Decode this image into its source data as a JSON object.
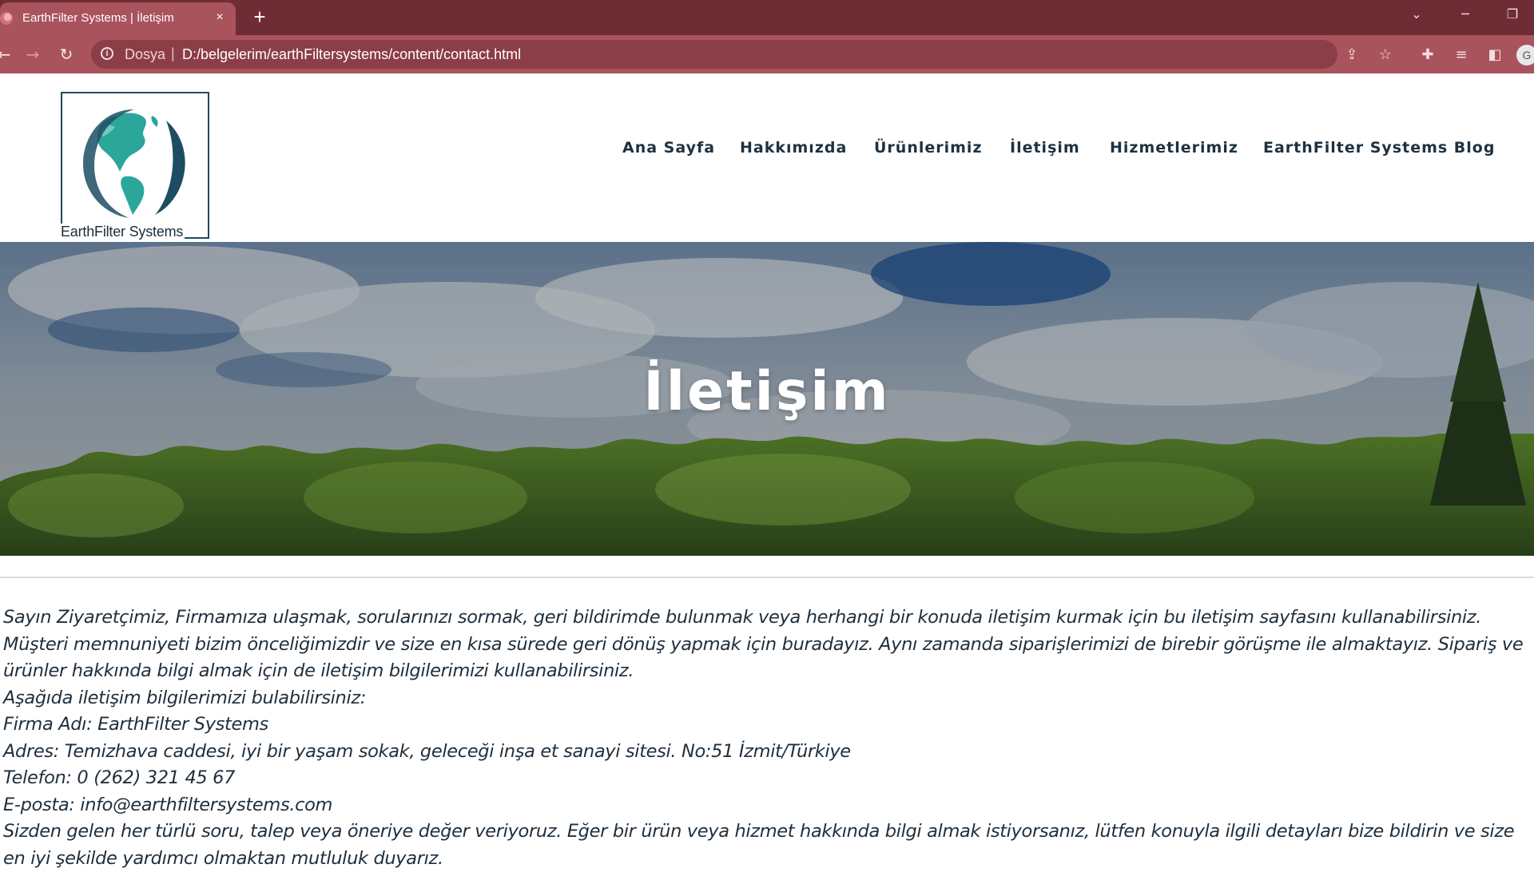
{
  "browser": {
    "tab_title": "EarthFilter Systems | İletişim",
    "tab_close": "×",
    "new_tab": "+",
    "address_scheme": "Dosya",
    "address_separator": "|",
    "address_url": "D:/belgelerim/earthFiltersystems/content/contact.html",
    "profile_initial": "G",
    "colors": {
      "tabstrip": "#6e2d35",
      "toolbar": "#a9535d"
    }
  },
  "logo": {
    "text": "EarthFilter Systems"
  },
  "nav": {
    "items": [
      {
        "label": "Ana Sayfa"
      },
      {
        "label": "Hakkımızda"
      },
      {
        "label": "Ürünlerimiz"
      },
      {
        "label": "İletişim"
      },
      {
        "label": "Hizmetlerimiz"
      },
      {
        "label": "EarthFilter Systems Blog"
      }
    ]
  },
  "hero": {
    "title": "İletişim"
  },
  "content": {
    "intro": "Sayın Ziyaretçimiz, Firmamıza ulaşmak, sorularınızı sormak, geri bildirimde bulunmak veya herhangi bir konuda iletişim kurmak için bu iletişim sayfasını kullanabilirsiniz. Müşteri memnuniyeti bizim önceliğimizdir ve size en kısa sürede geri dönüş yapmak için buradayız. Aynı zamanda siparişlerimizi de birebir görüşme ile almaktayız. Sipariş ve ürünler hakkında bilgi almak için de iletişim bilgilerimizi kullanabilirsiniz.",
    "info_heading": "Aşağıda iletişim bilgilerimizi bulabilirsiniz:",
    "company": "Firma Adı: EarthFilter Systems",
    "address": "Adres: Temizhava caddesi, iyi bir yaşam sokak, geleceği inşa et sanayi sitesi. No:51 İzmit/Türkiye",
    "phone": "Telefon: 0 (262) 321 45 67",
    "email": "E-posta: info@earthfiltersystems.com",
    "closing": "Sizden gelen her türlü soru, talep veya öneriye değer veriyoruz. Eğer bir ürün veya hizmet hakkında bilgi almak istiyorsanız, lütfen konuyla ilgili detayları bize bildirin ve size en iyi şekilde yardımcı olmaktan mutluluk duyarız."
  }
}
